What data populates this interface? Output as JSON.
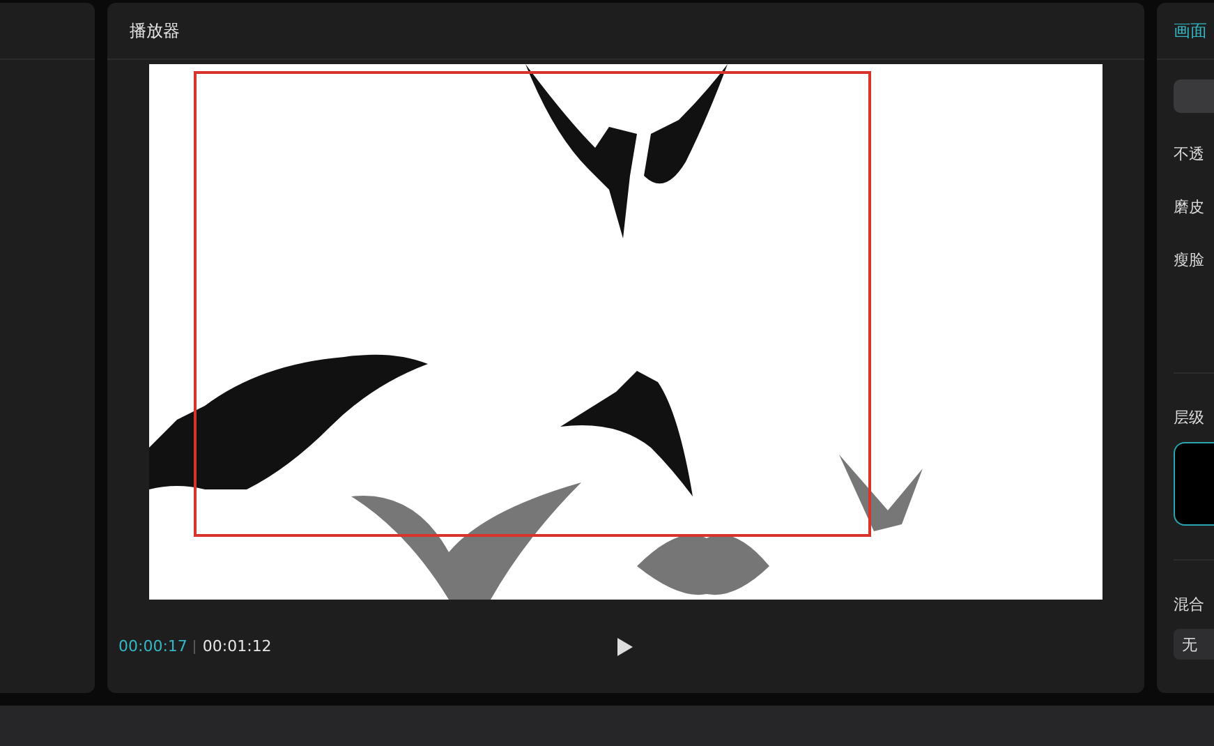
{
  "player": {
    "title": "播放器",
    "current_time": "00:00:17",
    "total_time": "00:01:12"
  },
  "inspector": {
    "tabs": [
      {
        "label": "画面",
        "selected": true
      }
    ],
    "rows": [
      {
        "kind": "label",
        "label": "不透"
      },
      {
        "kind": "label",
        "label": "磨皮"
      },
      {
        "kind": "label",
        "label": "瘦脸"
      },
      {
        "kind": "section",
        "label": "层级"
      },
      {
        "kind": "section",
        "label": "混合"
      },
      {
        "kind": "select",
        "label": "无"
      }
    ]
  }
}
